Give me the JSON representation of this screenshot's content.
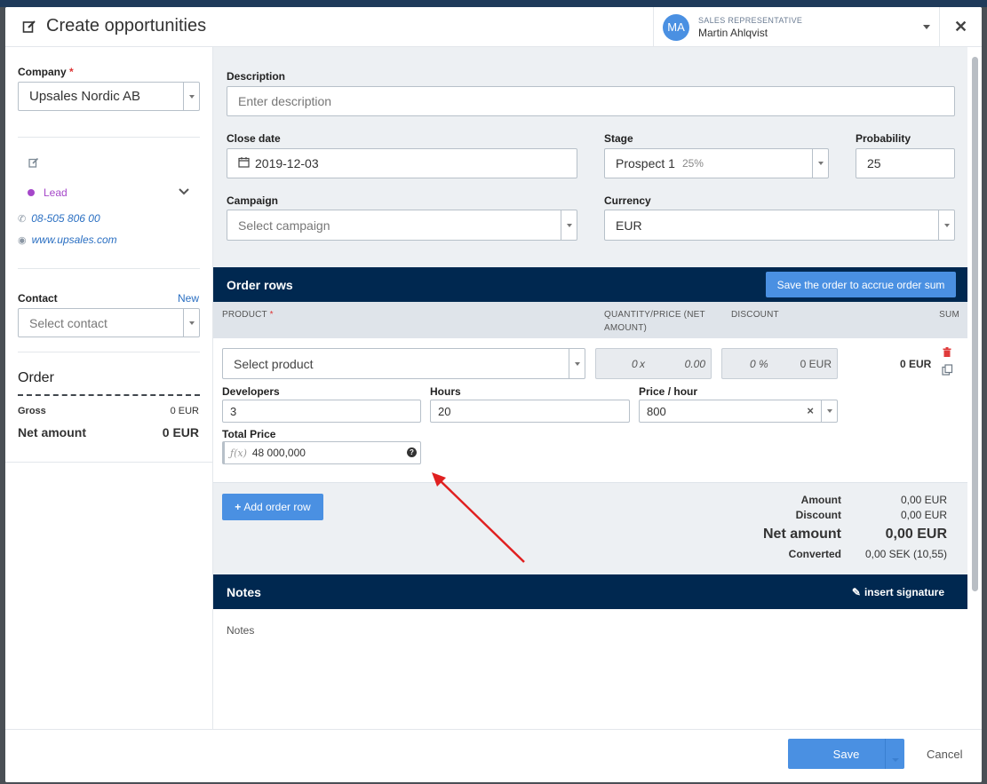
{
  "header": {
    "title": "Create opportunities",
    "rep_role": "SALES REPRESENTATIVE",
    "rep_name": "Martin Ahlqvist",
    "rep_initials": "MA",
    "close_icon": "close-icon"
  },
  "sidebar": {
    "company_label": "Company",
    "company_value": "Upsales Nordic AB",
    "lead_label": "Lead",
    "phone": "08-505 806 00",
    "website": "www.upsales.com",
    "contact_label": "Contact",
    "contact_new": "New",
    "contact_placeholder": "Select contact",
    "order_title": "Order",
    "gross_label": "Gross",
    "gross_value": "0 EUR",
    "net_label": "Net amount",
    "net_value": "0 EUR"
  },
  "form": {
    "description_label": "Description",
    "description_placeholder": "Enter description",
    "close_date_label": "Close date",
    "close_date_value": "2019-12-03",
    "stage_label": "Stage",
    "stage_value": "Prospect 1",
    "stage_percent": "25%",
    "probability_label": "Probability",
    "probability_value": "25",
    "campaign_label": "Campaign",
    "campaign_placeholder": "Select campaign",
    "currency_label": "Currency",
    "currency_value": "EUR"
  },
  "order_rows": {
    "title": "Order rows",
    "accrue_button": "Save the order to accrue order sum",
    "col_product": "PRODUCT",
    "col_qty_line1": "QUANTITY/PRICE (NET",
    "col_qty_line2": "AMOUNT)",
    "col_discount": "DISCOUNT",
    "col_sum": "SUM",
    "product_placeholder": "Select product",
    "qty_value": "0",
    "qty_mult": "x",
    "price_value": "0.00",
    "discount_value": "0",
    "discount_unit": "%",
    "discount_amount": "0 EUR",
    "row_sum": "0 EUR",
    "developers_label": "Developers",
    "developers_value": "3",
    "hours_label": "Hours",
    "hours_value": "20",
    "price_hour_label": "Price / hour",
    "price_hour_value": "800",
    "total_price_label": "Total Price",
    "fx_prefix": "ƒ(x)",
    "total_price_value": "48 000,000",
    "add_row_button": "Add order row"
  },
  "totals": {
    "amount_label": "Amount",
    "amount_value": "0,00 EUR",
    "discount_label": "Discount",
    "discount_value": "0,00 EUR",
    "net_label": "Net amount",
    "net_value": "0,00 EUR",
    "converted_label": "Converted",
    "converted_value": "0,00 SEK (10,55)"
  },
  "notes": {
    "title": "Notes",
    "insert_signature": "insert signature",
    "placeholder": "Notes"
  },
  "footer": {
    "save": "Save",
    "cancel": "Cancel"
  },
  "colors": {
    "navy": "#002850",
    "accent_blue": "#4a90e2",
    "lead_purple": "#a547c9",
    "annotation_red": "#e02020"
  }
}
